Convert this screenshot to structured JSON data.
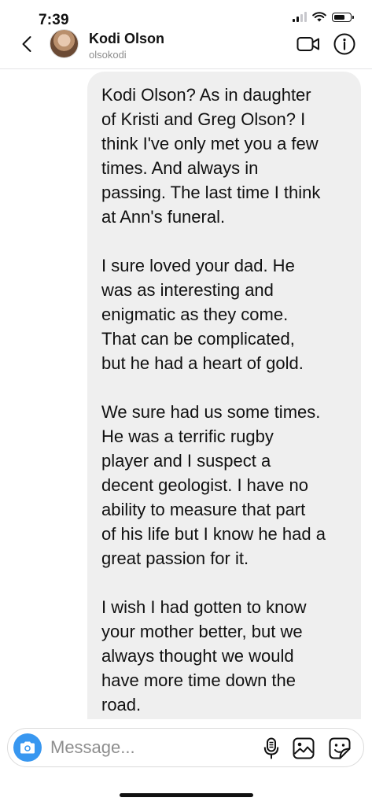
{
  "status_bar": {
    "time": "7:39"
  },
  "header": {
    "contact_name": "Kodi Olson",
    "contact_username": "olsokodi"
  },
  "conversation": {
    "message_paragraphs": [
      "Kodi Olson? As in daughter\nof Kristi and Greg Olson? I\nthink I've only met you a few\ntimes. And always in\npassing. The last time I think\nat Ann's funeral.",
      "I sure loved your dad. He\nwas as interesting and\nenigmatic as they come.\nThat can be complicated,\nbut he had a heart of gold.",
      "We sure had us some times.\nHe was a terrific rugby\nplayer and I suspect a\ndecent geologist. I have no\nability to measure that part\nof his life but I know he had a\ngreat passion for it.",
      "I wish I had gotten to know\nyour mother better, but we\nalways thought we would\nhave more time down the\nroad."
    ]
  },
  "composer": {
    "placeholder": "Message..."
  },
  "colors": {
    "accent": "#3897f0",
    "bubble_background": "#efefef",
    "secondary_text": "#8e8e8e"
  },
  "icons": {
    "back": "chevron-left-icon",
    "video": "video-camera-icon",
    "info": "info-icon",
    "camera": "camera-icon",
    "mic": "microphone-icon",
    "gallery": "image-gallery-icon",
    "sticker": "sticker-icon"
  }
}
